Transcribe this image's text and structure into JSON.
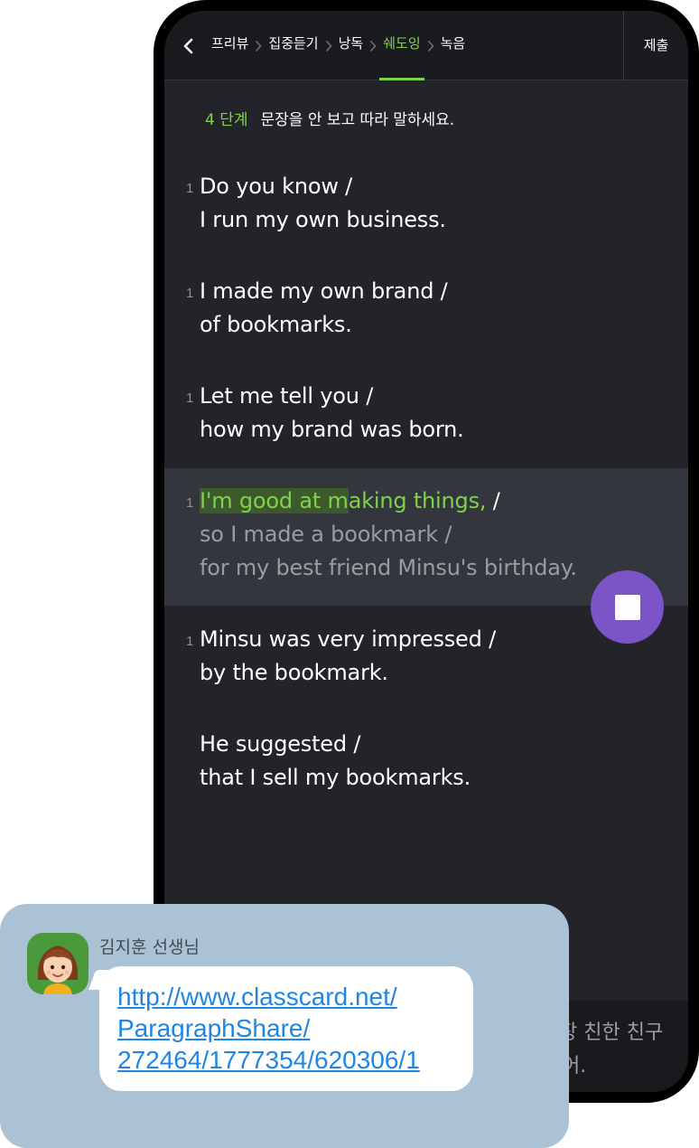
{
  "nav": {
    "steps": [
      "프리뷰",
      "집중듣기",
      "낭독",
      "쉐도잉",
      "녹음"
    ],
    "active_step": "쉐도잉",
    "submit_label": "제출"
  },
  "instruction": {
    "stage": "4 단계",
    "text": "문장을 안 보고 따라 말하세요."
  },
  "sentences": [
    {
      "number": "1",
      "lines": [
        "Do you know /",
        "I run my own business."
      ]
    },
    {
      "number": "1",
      "lines": [
        "I made my own brand /",
        "of bookmarks."
      ]
    },
    {
      "number": "1",
      "lines": [
        "Let me tell you /",
        "how my brand was born."
      ]
    },
    {
      "number": "1",
      "active": true,
      "spoken_highlighted": "I'm good at m",
      "spoken_rest": "aking things,",
      "first_line_tail": " /",
      "lines": [
        "I'm good at making things, /",
        "so I made a bookmark /",
        "for my best friend Minsu's birthday."
      ]
    },
    {
      "number": "1",
      "lines": [
        "Minsu was very impressed /",
        "by the bookmark."
      ]
    },
    {
      "number": "",
      "lines": [
        "He suggested /",
        "that I sell my bookmarks."
      ]
    }
  ],
  "translation_partial": {
    "line1": "장 친한 친구",
    "line2": "어."
  },
  "record_button": {
    "state": "recording",
    "icon": "stop-icon"
  },
  "chat": {
    "sender": "김지훈 선생님",
    "link": "http://www.classcard.net/\nParagraphShare/\n272464/1777354/620306/1"
  },
  "colors": {
    "accent_green": "#7fd34a",
    "record_purple": "#7b55c8",
    "chat_background": "#abc1d4",
    "link_blue": "#1f86e3"
  }
}
